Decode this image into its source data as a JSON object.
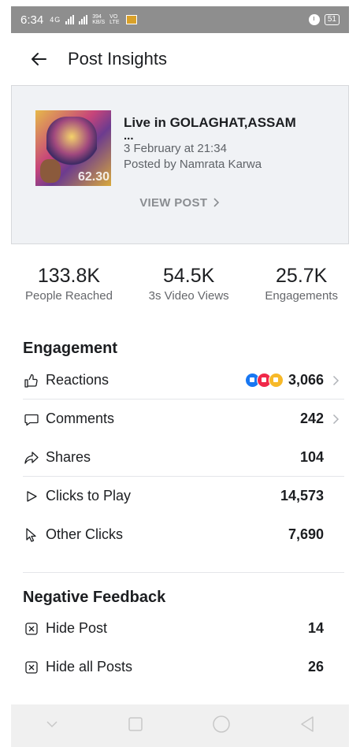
{
  "status_bar": {
    "time": "6:34",
    "network_label": "4G",
    "speed_value": "394",
    "speed_unit": "KB/S",
    "volte_top": "VO",
    "volte_bottom": "LTE",
    "battery": "51"
  },
  "header": {
    "title": "Post Insights",
    "back_icon": "arrow-left-icon"
  },
  "post": {
    "title": "Live in GOLAGHAT,ASSAM",
    "ellipsis": "...",
    "date": "3 February at 21:34",
    "posted_by": "Posted by Namrata Karwa",
    "view_post": "VIEW POST",
    "thumbnail_overlay": "62.30"
  },
  "stats": [
    {
      "value": "133.8K",
      "label": "People Reached"
    },
    {
      "value": "54.5K",
      "label": "3s Video Views"
    },
    {
      "value": "25.7K",
      "label": "Engagements"
    }
  ],
  "engagement": {
    "title": "Engagement",
    "rows": [
      {
        "label": "Reactions",
        "value": "3,066",
        "icon": "thumbs-up-icon"
      },
      {
        "label": "Comments",
        "value": "242",
        "icon": "comment-icon"
      },
      {
        "label": "Shares",
        "value": "104",
        "icon": "share-icon"
      },
      {
        "label": "Clicks to Play",
        "value": "14,573",
        "icon": "play-icon"
      },
      {
        "label": "Other Clicks",
        "value": "7,690",
        "icon": "cursor-icon"
      }
    ]
  },
  "negative_feedback": {
    "title": "Negative Feedback",
    "rows": [
      {
        "label": "Hide Post",
        "value": "14",
        "icon": "hide-icon"
      },
      {
        "label": "Hide all Posts",
        "value": "26",
        "icon": "hide-icon"
      }
    ]
  },
  "colors": {
    "like": "#1877f2",
    "love": "#f02849",
    "haha": "#f7b928",
    "status_bar": "#8e8e8e"
  }
}
